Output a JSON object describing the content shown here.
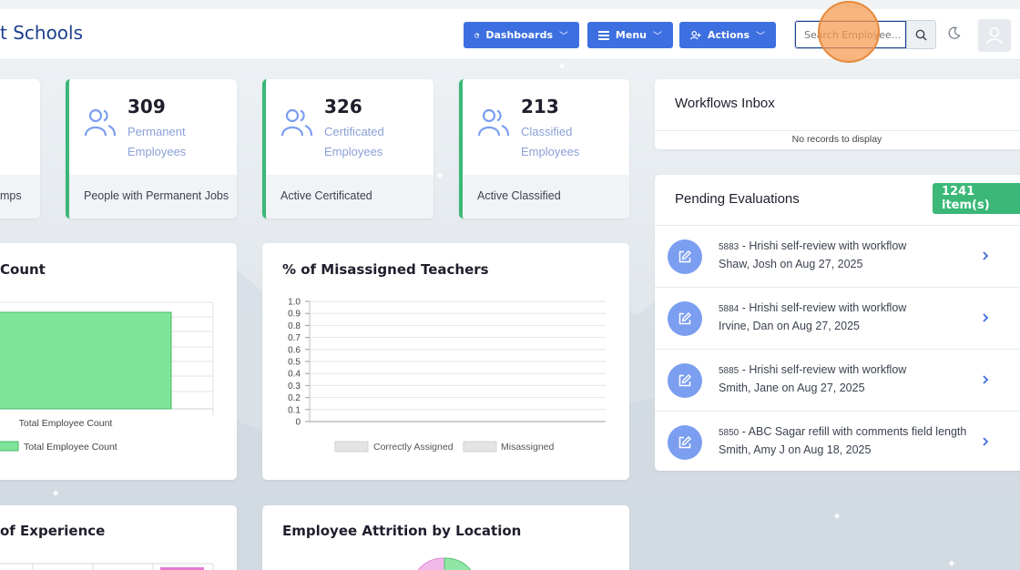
{
  "header": {
    "brand": "t Schools",
    "dashboards_label": "Dashboards",
    "menu_label": "Menu",
    "actions_label": "Actions",
    "search_placeholder": "Search Employee..."
  },
  "stats": [
    {
      "footer": "mps"
    },
    {
      "value": "309",
      "label_line1": "Permanent",
      "label_line2": "Employees",
      "footer": "People with Permanent Jobs"
    },
    {
      "value": "326",
      "label_line1": "Certificated",
      "label_line2": "Employees",
      "footer": "Active Certificated"
    },
    {
      "value": "213",
      "label_line1": "Classified",
      "label_line2": "Employees",
      "footer": "Active Classified"
    }
  ],
  "charts": {
    "count_title": "Count",
    "misassigned_title": "% of Misassigned Teachers",
    "experience_title": "of Experience",
    "attrition_title": "Employee Attrition by Location"
  },
  "chart_data": [
    {
      "type": "bar",
      "title": "Count",
      "categories": [
        "Total Employee Count"
      ],
      "series": [
        {
          "name": "Total Employee Count",
          "color": "#7ee59a"
        }
      ],
      "grid": true
    },
    {
      "type": "bar",
      "title": "% of Misassigned Teachers",
      "ylim": [
        0,
        1.0
      ],
      "yticks": [
        "1.0",
        "0.9",
        "0.8",
        "0.7",
        "0.6",
        "0.5",
        "0.4",
        "0.3",
        "0.2",
        "0.1",
        "0"
      ],
      "series": [
        {
          "name": "Correctly Assigned",
          "values": []
        },
        {
          "name": "Misassigned",
          "values": []
        }
      ],
      "legend": "bottom",
      "grid": true
    }
  ],
  "workflows": {
    "title": "Workflows Inbox",
    "empty_text": "No records to display"
  },
  "pending": {
    "title": "Pending Evaluations",
    "count_badge": "1241 item(s)",
    "items": [
      {
        "id": "5883",
        "title": " - Hrishi self-review with workflow",
        "subtitle": "Shaw, Josh on Aug 27, 2025"
      },
      {
        "id": "5884",
        "title": " - Hrishi self-review with workflow",
        "subtitle": "Irvine, Dan on Aug 27, 2025"
      },
      {
        "id": "5885",
        "title": " - Hrishi self-review with workflow",
        "subtitle": "Smith, Jane on Aug 27, 2025"
      },
      {
        "id": "5850",
        "title": " - ABC Sagar refill with comments field length",
        "subtitle": "Smith, Amy J on Aug 18, 2025"
      }
    ]
  },
  "colors": {
    "primary": "#3d6fe0",
    "accent_green": "#3bb878",
    "brand_text": "#1d3f8f"
  }
}
